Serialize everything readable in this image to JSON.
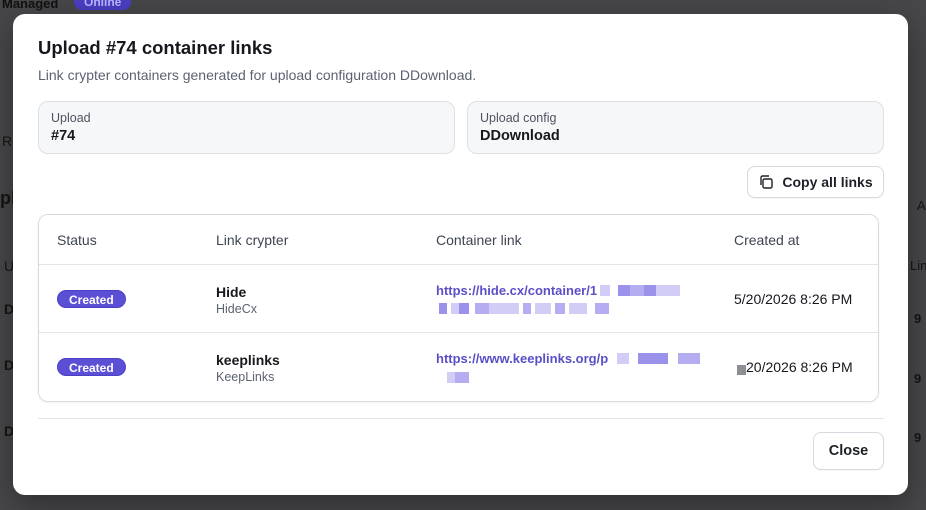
{
  "background": {
    "managed_label": "Managed",
    "online_badge": "Online",
    "left_fragments": [
      "Re",
      "pl",
      "U",
      "D",
      "D",
      "D"
    ],
    "right_fragments": [
      "A",
      "Link",
      "9",
      "9",
      "9"
    ]
  },
  "modal": {
    "title": "Upload #74 container links",
    "description": "Link crypter containers generated for upload configuration DDownload.",
    "upload": {
      "label": "Upload",
      "value": "#74"
    },
    "upload_config": {
      "label": "Upload config",
      "value": "DDownload"
    },
    "copy_all_label": "Copy all links",
    "close_label": "Close",
    "table": {
      "columns": [
        "Status",
        "Link crypter",
        "Container link",
        "Created at"
      ],
      "rows": [
        {
          "status": "Created",
          "crypter_name": "Hide",
          "crypter_sub": "HideCx",
          "link_visible": "https://hide.cx/container/1",
          "created_at": "5/20/2026 8:26 PM"
        },
        {
          "status": "Created",
          "crypter_name": "keeplinks",
          "crypter_sub": "KeepLinks",
          "link_visible": "https://www.keeplinks.org/p",
          "created_at": "20/2026 8:26 PM"
        }
      ]
    }
  },
  "colors": {
    "accent": "#5b4fd6",
    "link": "#5a4fc7",
    "overlay": "#47474a"
  },
  "icons": {
    "copy": "copy-icon"
  }
}
